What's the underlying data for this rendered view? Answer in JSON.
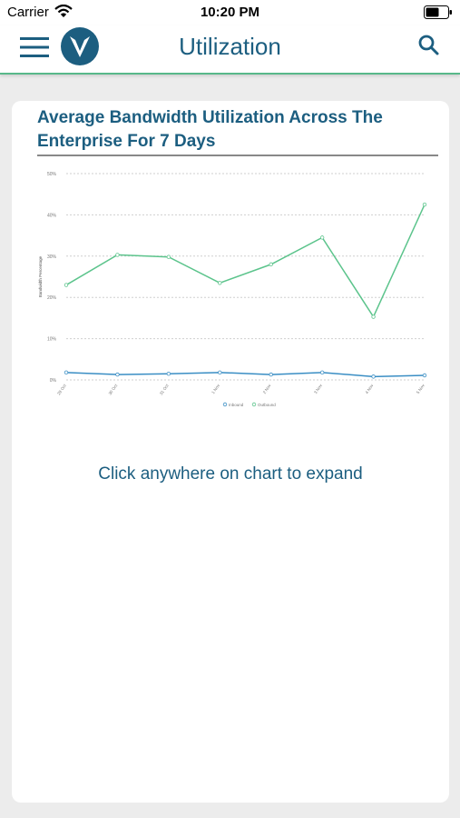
{
  "status_bar": {
    "carrier": "Carrier",
    "time": "10:20 PM"
  },
  "header": {
    "title": "Utilization",
    "accent_color": "#58b88a",
    "title_color": "#1c5e80"
  },
  "card": {
    "title": "Average Bandwidth Utilization Across The Enterprise For 7 Days",
    "expand_hint": "Click anywhere on chart to expand"
  },
  "chart_data": {
    "type": "line",
    "ylabel": "Bandwidth Percentage",
    "ylim": [
      0,
      50
    ],
    "y_ticks": [
      "0%",
      "10%",
      "20%",
      "30%",
      "40%",
      "50%"
    ],
    "categories": [
      "29 Oct",
      "30 Oct",
      "31 Oct",
      "1 Nov",
      "2 Nov",
      "3 Nov",
      "4 Nov",
      "5 Nov"
    ],
    "grid": true,
    "legend_position": "bottom",
    "series": [
      {
        "name": "Inbound",
        "color": "#3a8ec4",
        "values": [
          1.8,
          1.3,
          1.5,
          1.8,
          1.3,
          1.8,
          0.8,
          1.1
        ]
      },
      {
        "name": "Outbound",
        "color": "#5cc48c",
        "values": [
          23,
          30.3,
          29.8,
          23.5,
          28,
          34.5,
          15.3,
          42.5
        ]
      }
    ]
  }
}
